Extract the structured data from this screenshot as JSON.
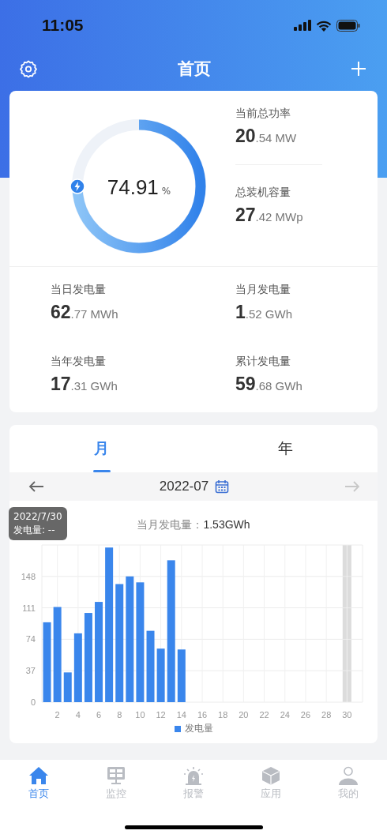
{
  "status_bar": {
    "time": "11:05"
  },
  "header": {
    "title": "首页"
  },
  "gauge": {
    "level": 0.7491,
    "value": "74.91",
    "unit": "%"
  },
  "top_stats": [
    {
      "label": "当前总功率",
      "value": "**20**.54 MW"
    },
    {
      "label": "总装机容量",
      "value": "**27**.42 MWp"
    }
  ],
  "stats": [
    {
      "label": "当日发电量",
      "value": "**62**.77 MWh"
    },
    {
      "label": "当月发电量",
      "value": "**1**.52 GWh"
    },
    {
      "label": "当年发电量",
      "value": "**17**.31 GWh"
    },
    {
      "label": "累计发电量",
      "value": "**59**.68 GWh"
    }
  ],
  "tabs": [
    {
      "label": "月",
      "selected": true
    },
    {
      "label": "年",
      "selected": false
    }
  ],
  "date_nav": {
    "date": "2022-07",
    "prev_disabled": false,
    "next_disabled": true
  },
  "summary": {
    "label": "当月发电量：",
    "value": "1.53GWh"
  },
  "tooltip": {
    "date": "2022/7/30",
    "text": "发电量: --"
  },
  "chart_data": {
    "type": "bar",
    "x": [
      1,
      2,
      3,
      4,
      5,
      6,
      7,
      8,
      9,
      10,
      11,
      12,
      13,
      14
    ],
    "xlim": [
      0.5,
      31.5
    ],
    "series": [
      {
        "name": "发电量",
        "color": "#3a86ec",
        "values": [
          94,
          112,
          35,
          81,
          105,
          118,
          182,
          139,
          148,
          141,
          84,
          63,
          167,
          62
        ]
      }
    ],
    "ylim": [
      0,
      185
    ],
    "yticks": [
      0,
      37,
      74,
      111,
      148
    ],
    "xticks": [
      2,
      4,
      6,
      8,
      10,
      12,
      14,
      16,
      18,
      20,
      22,
      24,
      26,
      28,
      30
    ],
    "grid": true,
    "ref_lines": [
      {
        "axis": "x",
        "value": 30
      }
    ]
  },
  "nav": [
    {
      "label": "首页",
      "selected": true
    },
    {
      "label": "监控",
      "selected": false
    },
    {
      "label": "报警",
      "selected": false
    },
    {
      "label": "应用",
      "selected": false
    },
    {
      "label": "我的",
      "selected": false
    }
  ]
}
